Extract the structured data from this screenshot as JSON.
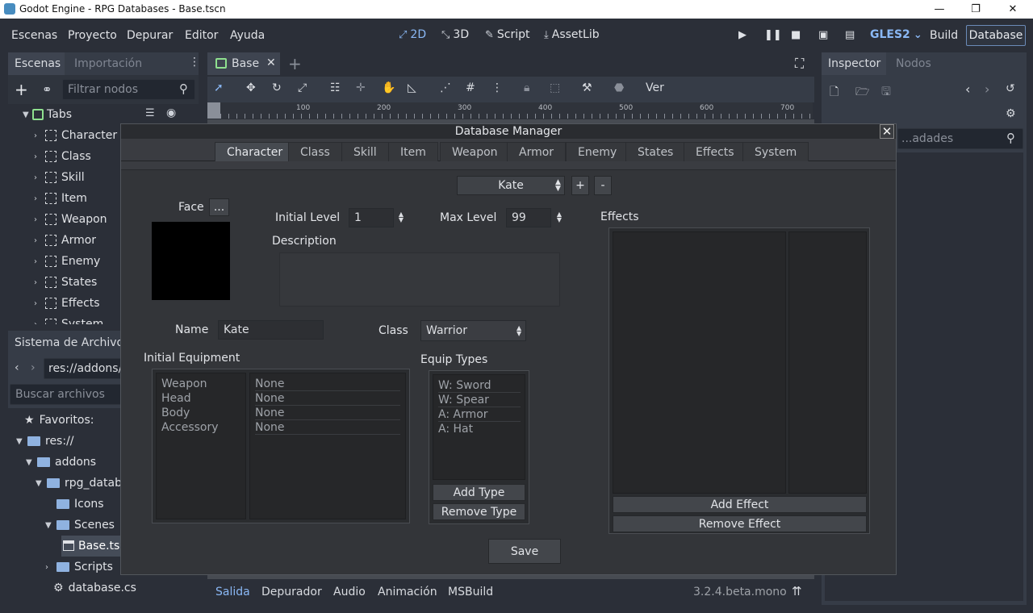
{
  "window": {
    "title": "Godot Engine - RPG Databases - Base.tscn",
    "controls": [
      "—",
      "❐",
      "✕"
    ]
  },
  "menubar": {
    "menus": [
      "Escenas",
      "Proyecto",
      "Depurar",
      "Editor",
      "Ayuda"
    ],
    "workspaces": [
      {
        "label": "2D",
        "icon": "⤢"
      },
      {
        "label": "3D",
        "icon": "⤡"
      },
      {
        "label": "Script",
        "icon": "✎"
      },
      {
        "label": "AssetLib",
        "icon": "⤓"
      }
    ],
    "renderer": "GLES2",
    "build": "Build",
    "database": "Database"
  },
  "scene_dock": {
    "tabs": [
      "Escenas",
      "Importación"
    ],
    "filter_placeholder": "Filtrar nodos",
    "root": "Tabs",
    "children": [
      "Character",
      "Class",
      "Skill",
      "Item",
      "Weapon",
      "Armor",
      "Enemy",
      "States",
      "Effects",
      "System"
    ]
  },
  "filesystem_dock": {
    "title": "Sistema de Archivos",
    "path": "res://addons/",
    "search_placeholder": "Buscar archivos",
    "favorites": "Favoritos:",
    "items": [
      {
        "label": "res://",
        "depth": 0,
        "type": "folder",
        "expanded": true
      },
      {
        "label": "addons",
        "depth": 1,
        "type": "folder",
        "expanded": true
      },
      {
        "label": "rpg_databa",
        "depth": 2,
        "type": "folder",
        "expanded": true
      },
      {
        "label": "Icons",
        "depth": 3,
        "type": "folder",
        "expanded": false
      },
      {
        "label": "Scenes",
        "depth": 3,
        "type": "folder",
        "expanded": true
      },
      {
        "label": "Base.tsc",
        "depth": 4,
        "type": "scene",
        "selected": true
      },
      {
        "label": "Scripts",
        "depth": 3,
        "type": "folder",
        "expanded": false
      },
      {
        "label": "database.cs",
        "depth": 3,
        "type": "script"
      }
    ]
  },
  "editor": {
    "scene_tab": "Base",
    "toolbar_view": "Ver",
    "ruler_ticks": [
      "100",
      "200",
      "300",
      "400",
      "500",
      "600",
      "700"
    ]
  },
  "inspector": {
    "tabs": [
      "Inspector",
      "Nodos"
    ],
    "filter_placeholder": "...adades"
  },
  "bottom": {
    "tabs": [
      "Salida",
      "Depurador",
      "Audio",
      "Animación",
      "MSBuild"
    ],
    "version": "3.2.4.beta.mono"
  },
  "dialog": {
    "title": "Database Manager",
    "tabs": [
      "Character",
      "Class",
      "Skill",
      "Item",
      "Weapon",
      "Armor",
      "Enemy",
      "States",
      "Effects",
      "System"
    ],
    "active_tab": "Character",
    "selector": {
      "value": "Kate",
      "add": "+",
      "remove": "-"
    },
    "face_label": "Face",
    "face_button": "...",
    "initial_level_label": "Initial Level",
    "initial_level": "1",
    "max_level_label": "Max Level",
    "max_level": "99",
    "description_label": "Description",
    "description": "",
    "name_label": "Name",
    "name": "Kate",
    "class_label": "Class",
    "class_value": "Warrior",
    "initial_equipment_label": "Initial Equipment",
    "equipment": [
      {
        "slot": "Weapon",
        "value": "None"
      },
      {
        "slot": "Head",
        "value": "None"
      },
      {
        "slot": "Body",
        "value": "None"
      },
      {
        "slot": "Accessory",
        "value": "None"
      }
    ],
    "equip_types_label": "Equip Types",
    "equip_types": [
      "W: Sword",
      "W: Spear",
      "A: Armor",
      "A: Hat"
    ],
    "add_type": "Add Type",
    "remove_type": "Remove Type",
    "effects_label": "Effects",
    "add_effect": "Add Effect",
    "remove_effect": "Remove Effect",
    "save": "Save"
  },
  "colors": {
    "accent": "#8ab8f5",
    "panel": "#363c47",
    "background": "#2b2f38"
  }
}
